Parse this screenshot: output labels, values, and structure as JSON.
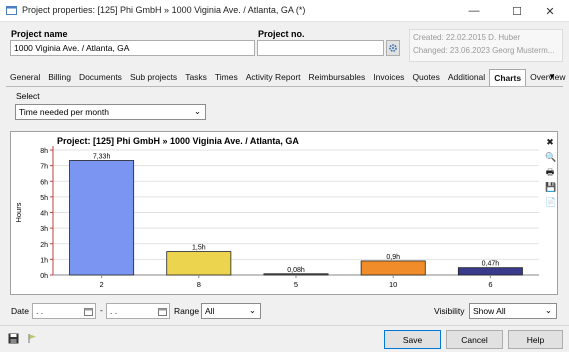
{
  "window": {
    "title": "Project properties: [125] Phi GmbH » 1000 Viginia Ave. / Atlanta, GA (*)",
    "minimize": "—",
    "maximize": "☐",
    "close": "✕"
  },
  "form": {
    "project_name_label": "Project name",
    "project_name_value": "1000 Viginia Ave. / Atlanta, GA",
    "project_no_label": "Project no.",
    "project_no_value": "",
    "created_text": "Created: 22.02.2015 D. Huber",
    "changed_text": "Changed: 23.06.2023 Georg Musterm..."
  },
  "tabs": [
    "General",
    "Billing",
    "Documents",
    "Sub projects",
    "Tasks",
    "Times",
    "Activity Report",
    "Reimbursables",
    "Invoices",
    "Quotes",
    "Additional",
    "Charts",
    "Overview"
  ],
  "active_tab": "Charts",
  "tabs_overflow_icon": "▼",
  "select": {
    "label": "Select",
    "value": "Time needed per month",
    "arrow": "⌄"
  },
  "chart_icons": [
    "close-icon",
    "zoom-icon",
    "print-icon",
    "save-icon",
    "copy-icon"
  ],
  "chart_icon_glyphs": [
    "✖",
    "🔍",
    "🖶",
    "💾",
    "📄"
  ],
  "chart_data": {
    "type": "bar",
    "title": "Project: [125] Phi GmbH » 1000 Viginia Ave. / Atlanta, GA",
    "ylabel": "Hours",
    "xlabel": "",
    "categories": [
      "2",
      "8",
      "5",
      "10",
      "6"
    ],
    "values": [
      7.33,
      1.5,
      0.08,
      0.9,
      0.47
    ],
    "value_labels": [
      "7,33h",
      "1,5h",
      "0,08h",
      "0,9h",
      "0,47h"
    ],
    "colors": [
      "#7b96f2",
      "#ecd44f",
      "#5c5c5c",
      "#f08c2a",
      "#3a3a8c"
    ],
    "ylim": [
      0,
      8
    ],
    "yticks": [
      "0h",
      "1h",
      "2h",
      "3h",
      "4h",
      "5h",
      "6h",
      "7h",
      "8h"
    ],
    "grid": true,
    "legend": "none"
  },
  "filters": {
    "date_label": "Date",
    "date_from": " . .",
    "dash": "-",
    "date_to": " . .",
    "range_label": "Range",
    "range_value": "All",
    "visibility_label": "Visibility",
    "visibility_value": "Show All"
  },
  "buttons": {
    "save": "Save",
    "cancel": "Cancel",
    "help": "Help"
  }
}
